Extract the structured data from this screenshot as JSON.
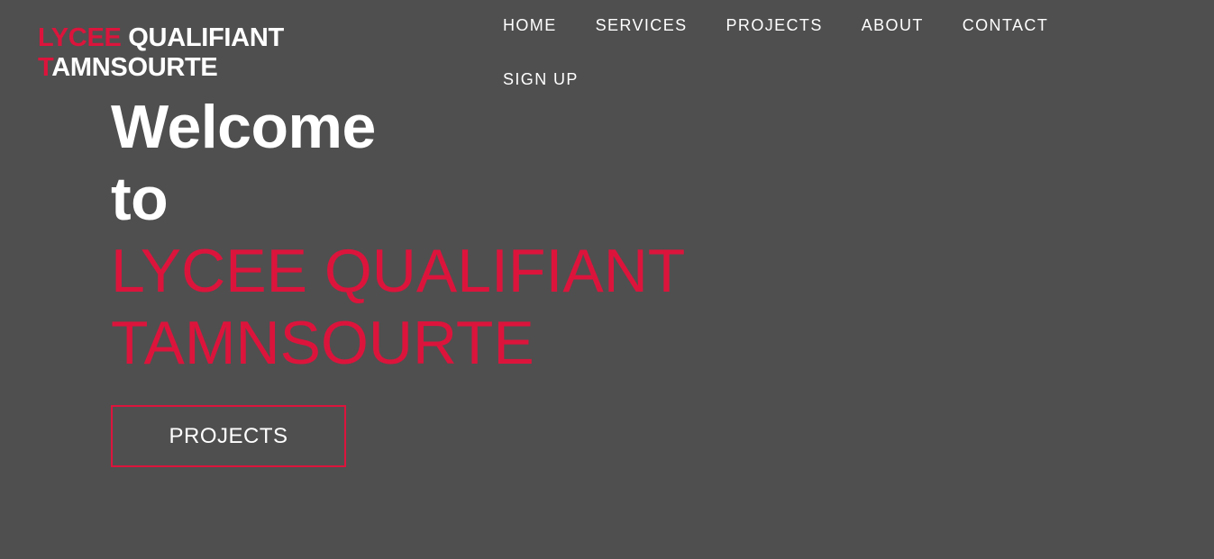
{
  "brand": {
    "line1_red": "LYCEE",
    "line1_white": "QUALIFIANT",
    "line2_red": "T",
    "line2_white": "AMNSOURTE"
  },
  "nav": {
    "items": [
      {
        "label": "HOME"
      },
      {
        "label": "SERVICES"
      },
      {
        "label": "PROJECTS"
      },
      {
        "label": "ABOUT"
      },
      {
        "label": "CONTACT"
      },
      {
        "label": "SIGN UP"
      }
    ]
  },
  "hero": {
    "welcome_line1": "Welcome",
    "welcome_line2": "to",
    "school_line1": "LYCEE QUALIFIANT",
    "school_line2": "TAMNSOURTE",
    "cta_label": "PROJECTS"
  },
  "colors": {
    "background": "#4f4f4f",
    "accent": "#dc143c",
    "text": "#ffffff"
  }
}
